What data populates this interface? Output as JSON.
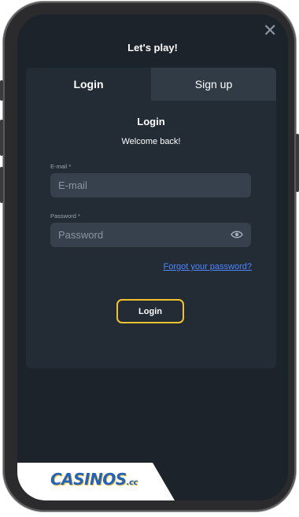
{
  "modal": {
    "title": "Let's play!",
    "close_icon": "close-icon"
  },
  "tabs": [
    {
      "label": "Login",
      "active": true
    },
    {
      "label": "Sign up",
      "active": false
    }
  ],
  "form": {
    "title": "Login",
    "subtitle": "Welcome back!",
    "email": {
      "label": "E-mail *",
      "placeholder": "E-mail",
      "value": ""
    },
    "password": {
      "label": "Password *",
      "placeholder": "Password",
      "value": "",
      "toggle_icon": "eye-icon"
    },
    "forgot_link": "Forgot your password?",
    "submit_label": "Login"
  },
  "brand": {
    "logo_text": "CASINOS",
    "logo_suffix": ".cc"
  },
  "colors": {
    "background": "#1c232b",
    "card": "#232c35",
    "tab_inactive": "#303b46",
    "input": "#36414d",
    "accent": "#f2c230",
    "link": "#4d86ff",
    "logo": "#2563b8"
  }
}
